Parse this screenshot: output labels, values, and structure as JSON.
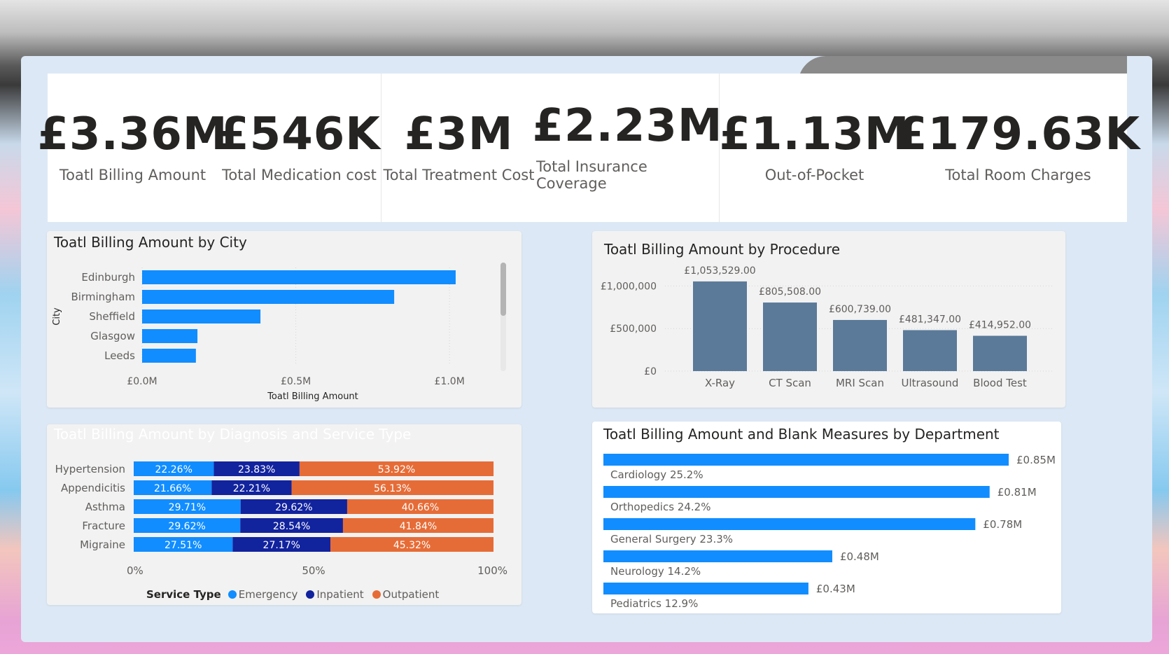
{
  "kpis": [
    {
      "value": "£3.36M",
      "label": "Toatl Billing Amount"
    },
    {
      "value": "£546K",
      "label": "Total Medication cost"
    },
    {
      "value": "£3M",
      "label": "Total Treatment Cost"
    },
    {
      "value": "£2.23M",
      "label": "Total Insurance Coverage"
    },
    {
      "value": "£1.13M",
      "label": "Out-of-Pocket"
    },
    {
      "value": "£179.63K",
      "label": "Total Room Charges"
    }
  ],
  "colors": {
    "bar_blue": "#118dff",
    "navy": "#12239e",
    "orange": "#e66c37",
    "slate": "#5b7a99"
  },
  "chart_data": [
    {
      "id": "city",
      "type": "bar",
      "orientation": "horizontal",
      "title": "Toatl Billing Amount by City",
      "xlabel": "Toatl Billing Amount",
      "ylabel": "City",
      "categories": [
        "Edinburgh",
        "Birmingham",
        "Sheffield",
        "Glasgow",
        "Leeds"
      ],
      "values": [
        1020000,
        820000,
        385000,
        180000,
        175000
      ],
      "xlim": [
        0,
        1200000
      ],
      "xticks": [
        0,
        500000,
        1000000
      ],
      "xtick_labels": [
        "£0.0M",
        "£0.5M",
        "£1.0M"
      ],
      "grid": true
    },
    {
      "id": "procedure",
      "type": "bar",
      "title": "Toatl Billing Amount by Procedure",
      "categories": [
        "X-Ray",
        "CT Scan",
        "MRI Scan",
        "Ultrasound",
        "Blood Test"
      ],
      "values": [
        1053529,
        805508,
        600739,
        481347,
        414952
      ],
      "data_labels": [
        "£1,053,529.00",
        "£805,508.00",
        "£600,739.00",
        "£481,347.00",
        "£414,952.00"
      ],
      "ylim": [
        0,
        1250000
      ],
      "yticks": [
        0,
        500000,
        1000000
      ],
      "ytick_labels": [
        "£0",
        "£500,000",
        "£1,000,000"
      ],
      "grid": true
    },
    {
      "id": "diagnosis",
      "type": "bar",
      "orientation": "horizontal",
      "stacked": "100%",
      "title": "Toatl Billing Amount by Diagnosis and Service Type",
      "categories": [
        "Hypertension",
        "Appendicitis",
        "Asthma",
        "Fracture",
        "Migraine"
      ],
      "series": [
        {
          "name": "Emergency",
          "values": [
            22.26,
            21.66,
            29.71,
            29.62,
            27.51
          ],
          "labels": [
            "22.26%",
            "21.66%",
            "29.71%",
            "29.62%",
            "27.51%"
          ]
        },
        {
          "name": "Inpatient",
          "values": [
            23.83,
            22.21,
            29.62,
            28.54,
            27.17
          ],
          "labels": [
            "23.83%",
            "22.21%",
            "29.62%",
            "28.54%",
            "27.17%"
          ]
        },
        {
          "name": "Outpatient",
          "values": [
            53.92,
            56.13,
            40.66,
            41.84,
            45.32
          ],
          "labels": [
            "53.92%",
            "56.13%",
            "40.66%",
            "41.84%",
            "45.32%"
          ]
        }
      ],
      "xticks": [
        0,
        50,
        100
      ],
      "xtick_labels": [
        "0%",
        "50%",
        "100%"
      ],
      "legend_title": "Service Type",
      "legend_position": "bottom"
    },
    {
      "id": "department",
      "type": "bar",
      "orientation": "horizontal",
      "title": "Toatl Billing Amount and Blank Measures by Department",
      "categories": [
        "Cardiology 25.2%",
        "Orthopedics 24.2%",
        "General Surgery 23.3%",
        "Neurology 14.2%",
        "Pediatrics 12.9%"
      ],
      "values": [
        0.85,
        0.81,
        0.78,
        0.48,
        0.43
      ],
      "data_labels": [
        "£0.85M",
        "£0.81M",
        "£0.78M",
        "£0.48M",
        "£0.43M"
      ],
      "xlim": [
        0,
        0.85
      ]
    }
  ]
}
